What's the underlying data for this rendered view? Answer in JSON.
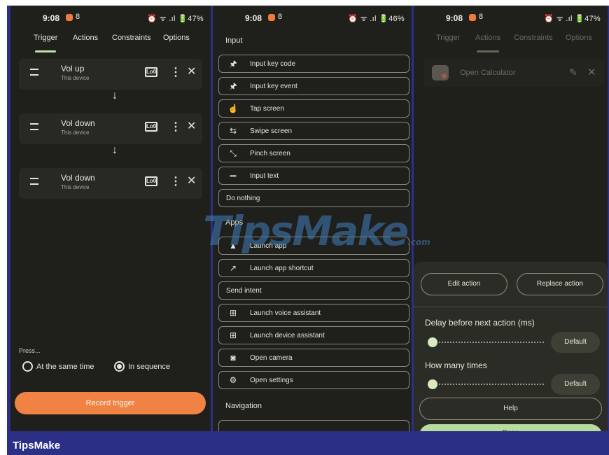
{
  "brand": "TipsMake",
  "watermark": {
    "main": "TipsMake",
    "suffix": ".com"
  },
  "screen1": {
    "status": {
      "time": "9:08",
      "notif": "8",
      "right": "⏰ ᯤ .ıl 🔋47%"
    },
    "tabs": [
      "Trigger",
      "Actions",
      "Constraints",
      "Options"
    ],
    "triggers": [
      {
        "title": "Vol up",
        "subtitle": "This device"
      },
      {
        "title": "Vol down",
        "subtitle": "This device"
      },
      {
        "title": "Vol down",
        "subtitle": "This device"
      }
    ],
    "press_label": "Press...",
    "radio_same": "At the same time",
    "radio_seq": "In sequence",
    "record_button": "Record trigger",
    "device_icon_text": "Lo0"
  },
  "screen2": {
    "status": {
      "time": "9:08",
      "notif": "8",
      "right": "⏰ ᯤ .ıl 🔋46%"
    },
    "sections": {
      "input": "Input",
      "apps": "Apps",
      "navigation": "Navigation"
    },
    "input_items": [
      {
        "label": "Input key code",
        "icon": "pin-icon"
      },
      {
        "label": "Input key event",
        "icon": "pin-icon"
      },
      {
        "label": "Tap screen",
        "icon": "tap-icon"
      },
      {
        "label": "Swipe screen",
        "icon": "swipe-icon"
      },
      {
        "label": "Pinch screen",
        "icon": "pinch-icon"
      },
      {
        "label": "Input text",
        "icon": "text-icon"
      }
    ],
    "do_nothing": "Do nothing",
    "app_items": [
      {
        "label": "Launch app",
        "icon": "android-icon"
      },
      {
        "label": "Launch app shortcut",
        "icon": "shortcut-icon"
      }
    ],
    "send_intent": "Send intent",
    "more_items": [
      {
        "label": "Launch voice assistant",
        "icon": "voice-assistant-icon"
      },
      {
        "label": "Launch device assistant",
        "icon": "device-assistant-icon"
      },
      {
        "label": "Open camera",
        "icon": "camera-icon"
      },
      {
        "label": "Open settings",
        "icon": "settings-icon"
      }
    ]
  },
  "screen3": {
    "status": {
      "time": "9:08",
      "notif": "8",
      "right": "⏰ ᯤ .ıl 🔋47%"
    },
    "tabs": [
      "Trigger",
      "Actions",
      "Constraints",
      "Options"
    ],
    "action_name": "Open Calculator",
    "edit_action": "Edit action",
    "replace_action": "Replace action",
    "delay_label": "Delay before next action (ms)",
    "times_label": "How many times",
    "default_label": "Default",
    "delay_value": 0,
    "times_value": 0,
    "help": "Help",
    "done": "Done"
  },
  "colors": {
    "accent": "#f08243",
    "green": "#b8dc9d",
    "frame": "#2c2f86"
  }
}
